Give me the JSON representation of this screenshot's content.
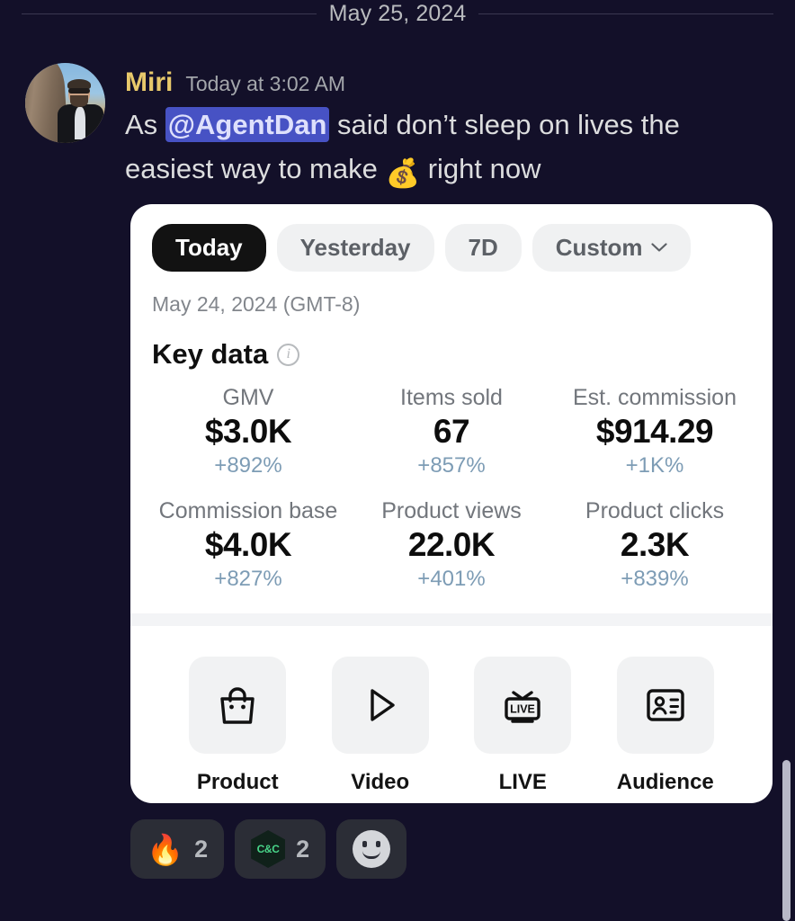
{
  "date_divider": {
    "label": "May 25, 2024"
  },
  "message": {
    "author": "Miri",
    "timestamp": "Today at 3:02 AM",
    "text_before": "As ",
    "mention": "@AgentDan",
    "text_middle": " said don’t sleep on lives the easiest way to make ",
    "emoji": "💰",
    "text_after": " right now"
  },
  "card": {
    "tabs": [
      {
        "label": "Today",
        "active": true
      },
      {
        "label": "Yesterday",
        "active": false
      },
      {
        "label": "7D",
        "active": false
      },
      {
        "label": "Custom",
        "active": false,
        "icon": "chevron-down-icon"
      }
    ],
    "date_range": "May 24, 2024 (GMT-8)",
    "section_title": "Key data",
    "info_icon": "info-icon",
    "metrics": [
      {
        "label": "GMV",
        "value": "$3.0K",
        "delta": "+892%"
      },
      {
        "label": "Items sold",
        "value": "67",
        "delta": "+857%"
      },
      {
        "label": "Est. commission",
        "value": "$914.29",
        "delta": "+1K%"
      },
      {
        "label": "Commission base",
        "value": "$4.0K",
        "delta": "+827%"
      },
      {
        "label": "Product views",
        "value": "22.0K",
        "delta": "+401%"
      },
      {
        "label": "Product clicks",
        "value": "2.3K",
        "delta": "+839%"
      }
    ],
    "shortcuts": [
      {
        "label": "Product",
        "icon": "shopping-bag-icon"
      },
      {
        "label": "Video",
        "icon": "play-triangle-icon"
      },
      {
        "label": "LIVE",
        "icon": "live-tv-icon"
      },
      {
        "label": "Audience",
        "icon": "id-card-icon"
      }
    ]
  },
  "reactions": [
    {
      "glyph": "🔥",
      "name": "fire-emoji",
      "count": "2"
    },
    {
      "glyph": "C&C",
      "name": "cnc-badge-emoji",
      "count": "2"
    }
  ],
  "add_reaction": {
    "icon": "add-reaction-icon"
  },
  "colors": {
    "background": "#131029",
    "card": "#ffffff",
    "author": "#e8c96b",
    "mention_bg": "#4752c4",
    "delta": "#7d9cb5",
    "active_tab_bg": "#121212"
  }
}
